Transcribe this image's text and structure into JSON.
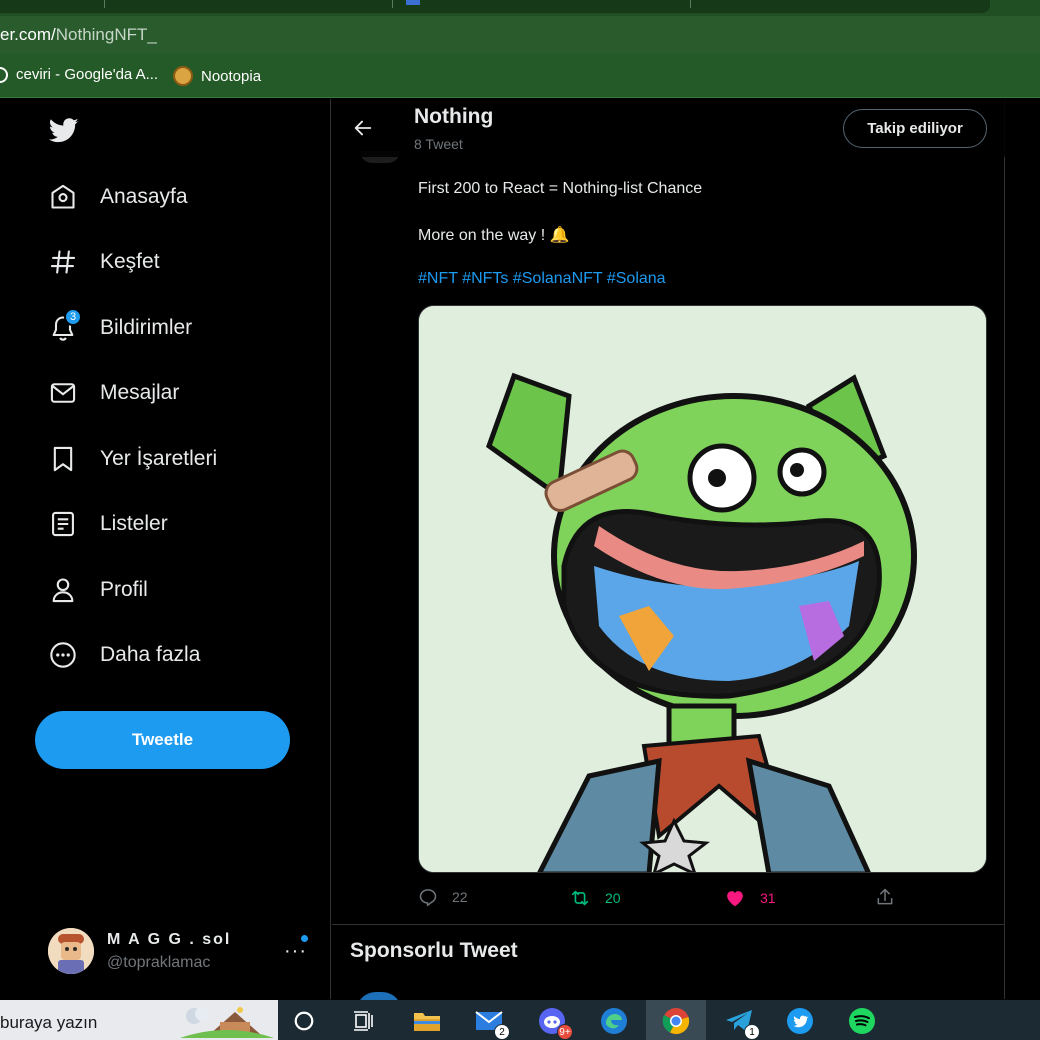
{
  "browser": {
    "url_host": "er.com/",
    "url_path": "NothingNFT_",
    "bookmarks": [
      {
        "label": "ceviri - Google'da A..."
      },
      {
        "label": "Nootopia"
      }
    ]
  },
  "sidebar": {
    "items": [
      {
        "label": "Anasayfa",
        "icon": "home-icon"
      },
      {
        "label": "Keşfet",
        "icon": "hashtag-icon"
      },
      {
        "label": "Bildirimler",
        "icon": "bell-icon",
        "badge": "3"
      },
      {
        "label": "Mesajlar",
        "icon": "envelope-icon"
      },
      {
        "label": "Yer İşaretleri",
        "icon": "bookmark-icon"
      },
      {
        "label": "Listeler",
        "icon": "list-icon"
      },
      {
        "label": "Profil",
        "icon": "person-icon"
      },
      {
        "label": "Daha fazla",
        "icon": "more-circle-icon"
      }
    ],
    "tweet_button": "Tweetle",
    "account": {
      "name": "M A G G . sol",
      "handle": "@topraklamac",
      "more": "···"
    }
  },
  "profile_header": {
    "name": "Nothing",
    "tweet_count": "8 Tweet",
    "follow_button": "Takip ediliyor"
  },
  "tweet": {
    "line1": "First 200 to React = Nothing-list Chance",
    "line2": "More on the way ! 🔔",
    "hashtags": [
      "#NFT",
      "#NFTs",
      "#SolanaNFT",
      "#Solana"
    ],
    "replies": "22",
    "retweets": "20",
    "likes": "31"
  },
  "sponsored": {
    "title": "Sponsorlu Tweet"
  },
  "taskbar": {
    "search_text": "buraya yazın",
    "mail_badge": "2",
    "discord_badge": "9+",
    "telegram_badge": "1"
  },
  "colors": {
    "accent": "#1d9bf0",
    "retweet_green": "#00ba7c",
    "like_pink": "#f91880",
    "browser_green": "#2a5b2d"
  }
}
